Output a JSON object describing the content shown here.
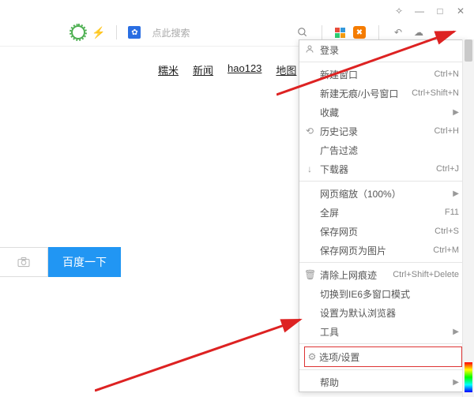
{
  "titlebar": {
    "min": "—",
    "max": "□",
    "close": "✕",
    "extra": "✧"
  },
  "toolbar": {
    "search_placeholder": "点此搜索",
    "undo": "↶",
    "cloud": "☁",
    "device": "▭"
  },
  "nav": [
    "糯米",
    "新闻",
    "hao123",
    "地图"
  ],
  "search_button": "百度一下",
  "menu": {
    "login": "登录",
    "items": [
      {
        "label": "新建窗口",
        "shortcut": "Ctrl+N"
      },
      {
        "label": "新建无痕/小号窗口",
        "shortcut": "Ctrl+Shift+N"
      },
      {
        "label": "收藏",
        "chev": true
      },
      {
        "label": "历史记录",
        "shortcut": "Ctrl+H",
        "icon": "⟲"
      },
      {
        "label": "广告过滤"
      },
      {
        "label": "下载器",
        "shortcut": "Ctrl+J",
        "icon": "↓"
      }
    ],
    "items2": [
      {
        "label": "网页缩放（100%）",
        "chev": true
      },
      {
        "label": "全屏",
        "shortcut": "F11"
      },
      {
        "label": "保存网页",
        "shortcut": "Ctrl+S"
      },
      {
        "label": "保存网页为图片",
        "shortcut": "Ctrl+M"
      }
    ],
    "items3": [
      {
        "label": "清除上网痕迹",
        "shortcut": "Ctrl+Shift+Delete",
        "icon": "🗑"
      },
      {
        "label": "切换到IE6多窗口模式"
      },
      {
        "label": "设置为默认浏览器"
      },
      {
        "label": "工具",
        "chev": true
      }
    ],
    "options": {
      "label": "选项/设置",
      "icon": "⚙"
    },
    "help": {
      "label": "帮助",
      "chev": true
    }
  }
}
